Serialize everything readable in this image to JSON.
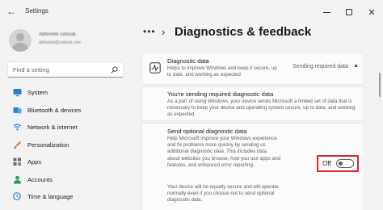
{
  "window": {
    "title": "Settings"
  },
  "user": {
    "name": "Abhishek Ghosal",
    "email": "abhishek@outlook.com"
  },
  "search": {
    "placeholder": "Find a setting"
  },
  "nav": {
    "items": [
      {
        "label": "System",
        "icon": "monitor-icon",
        "color": "#0067c0"
      },
      {
        "label": "Bluetooth & devices",
        "icon": "bluetooth-icon",
        "color": "#0067c0"
      },
      {
        "label": "Network & internet",
        "icon": "network-icon",
        "color": "#0067c0"
      },
      {
        "label": "Personalization",
        "icon": "brush-icon",
        "color": "#e07a1f"
      },
      {
        "label": "Apps",
        "icon": "apps-icon",
        "color": "#6b6b6b"
      },
      {
        "label": "Accounts",
        "icon": "person-icon",
        "color": "#2aa05a"
      },
      {
        "label": "Time & language",
        "icon": "globe-clock-icon",
        "color": "#0067c0"
      }
    ]
  },
  "breadcrumb": {
    "dots": "•••",
    "chevron": "›"
  },
  "page": {
    "title": "Diagnostics & feedback"
  },
  "diagnostic_data": {
    "title": "Diagnostic data",
    "description": "Helps to improve Windows and keep it secure, up to date, and working as expected",
    "status": "Sending required data"
  },
  "required": {
    "title": "You're sending required diagnostic data",
    "description": "As a part of using Windows, your device sends Microsoft a limited set of data that is necessary to keep your device and operating system secure, up to date, and working as expected."
  },
  "optional": {
    "title": "Send optional diagnostic data",
    "description": "Help Microsoft improve your Windows experience and fix problems more quickly by sending us additional diagnostic data. This includes data about websites you browse, how you use apps and features, and enhanced error reporting.",
    "note": "Your device will be equally secure and will operate normally even if you choose not to send optional diagnostic data.",
    "toggle_label": "Off",
    "toggle_on": false,
    "highlight_color": "#d9262b"
  }
}
